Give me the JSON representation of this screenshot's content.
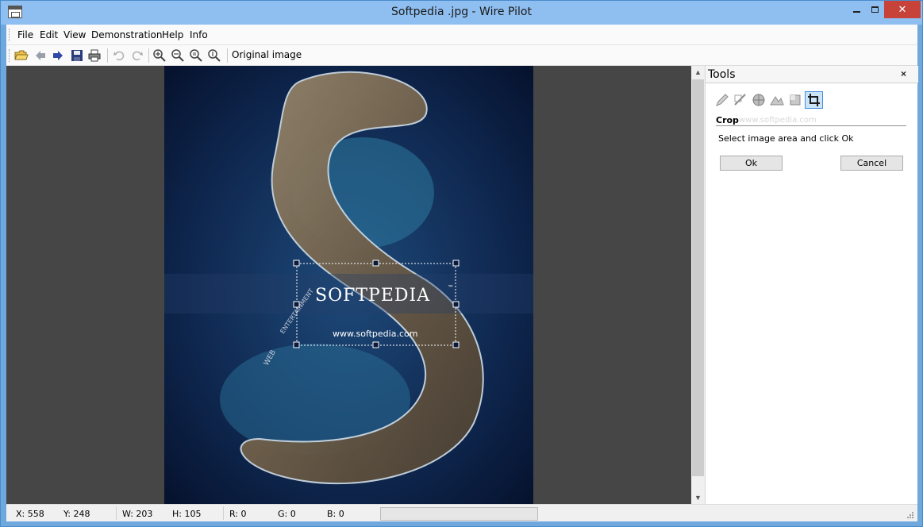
{
  "window": {
    "title": "Softpedia .jpg - Wire Pilot",
    "minimize_icon": "minimize-icon",
    "maximize_icon": "maximize-icon",
    "close_icon": "close-icon",
    "close_glyph": "✕"
  },
  "menu": {
    "items": [
      "File",
      "Edit",
      "View",
      "Demonstration",
      "Help",
      "Info"
    ]
  },
  "toolbar": {
    "icons": [
      "open-folder-icon",
      "back-arrow-icon",
      "forward-arrow-icon",
      "save-icon",
      "print-icon",
      "undo-icon",
      "redo-icon",
      "zoom-in-icon",
      "zoom-out-icon",
      "zoom-fit-icon",
      "zoom-actual-icon"
    ],
    "original_image_label": "Original image"
  },
  "image": {
    "watermark_brand": "SOFTPEDIA",
    "watermark_tm": "™",
    "watermark_url": "www.softpedia.com",
    "watermark_web": "WEB",
    "watermark_ent": "ENTERTAINMENT"
  },
  "tools_panel": {
    "title": "Tools",
    "close_glyph": "×",
    "tool_icons": [
      "pencil-icon",
      "line-icon",
      "color-wheel-icon",
      "shape-icon",
      "fill-icon",
      "crop-icon"
    ],
    "section_title": "Crop",
    "hint": "Select image area and click Ok",
    "ok_label": "Ok",
    "cancel_label": "Cancel",
    "ghost_text": "www.softpedia.com"
  },
  "status": {
    "x": "X: 558",
    "y": "Y: 248",
    "w": "W: 203",
    "h": "H: 105",
    "r": "R: 0",
    "g": "G: 0",
    "b": "B: 0"
  },
  "colors": {
    "accent": "#3d8ee0",
    "titlebar": "#8fbff0",
    "workspace": "#464646",
    "close_button": "#c7433a"
  }
}
